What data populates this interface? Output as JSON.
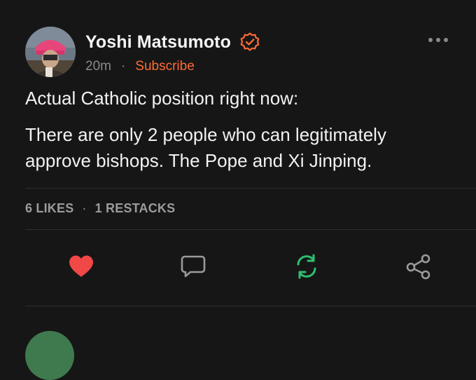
{
  "author": {
    "name": "Yoshi Matsumoto",
    "verified_icon": "check-badge-icon",
    "time": "20m",
    "separator": "·",
    "subscribe_label": "Subscribe"
  },
  "post": {
    "paragraphs": [
      "Actual Catholic position right now:",
      "There are only 2 people who can legitimately approve bishops. The Pope and Xi Jinping."
    ]
  },
  "stats": {
    "likes": "6 LIKES",
    "separator": "·",
    "restacks": "1 RESTACKS"
  },
  "actions": [
    {
      "icon": "heart-icon",
      "color": "#f04747"
    },
    {
      "icon": "comment-icon",
      "color": "#9a9a9a"
    },
    {
      "icon": "restack-icon",
      "color": "#2fbf71"
    },
    {
      "icon": "share-icon",
      "color": "#9a9a9a"
    }
  ],
  "colors": {
    "background": "#161616",
    "accent": "#ff6b33",
    "muted": "#8a8a8a"
  }
}
